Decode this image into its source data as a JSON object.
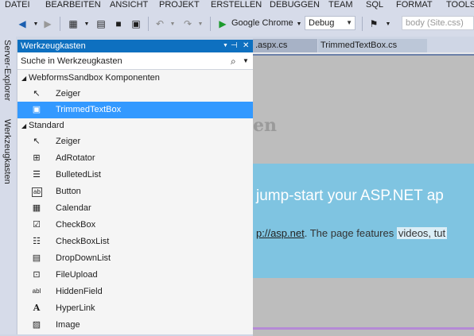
{
  "menubar": [
    "DATEI",
    "BEARBEITEN",
    "ANSICHT",
    "PROJEKT",
    "ERSTELLEN",
    "DEBUGGEN",
    "TEAM",
    "SQL",
    "FORMAT",
    "TOOLS"
  ],
  "toolbar": {
    "run_target": "Google Chrome",
    "config": "Debug",
    "css_target": "body (Site.css)"
  },
  "side_tabs": [
    "Server-Explorer",
    "Werkzeugkasten"
  ],
  "toolbox": {
    "title": "Werkzeugkasten",
    "search_placeholder": "Suche in Werkzeugkasten",
    "group1": "WebformsSandbox Komponenten",
    "group1_items": [
      "Zeiger",
      "TrimmedTextBox"
    ],
    "group2": "Standard",
    "group2_items": [
      "Zeiger",
      "AdRotator",
      "BulletedList",
      "Button",
      "Calendar",
      "CheckBox",
      "CheckBoxList",
      "DropDownList",
      "FileUpload",
      "HiddenField",
      "HyperLink",
      "Image"
    ]
  },
  "editor": {
    "tabs": [
      ".aspx.cs",
      "TrimmedTextBox.cs"
    ],
    "heading": "en",
    "hero_heading": "jump-start your ASP.NET ap",
    "hero_link": "p://asp.net",
    "hero_text": ". The page features ",
    "hero_highlight": "videos, tut"
  }
}
